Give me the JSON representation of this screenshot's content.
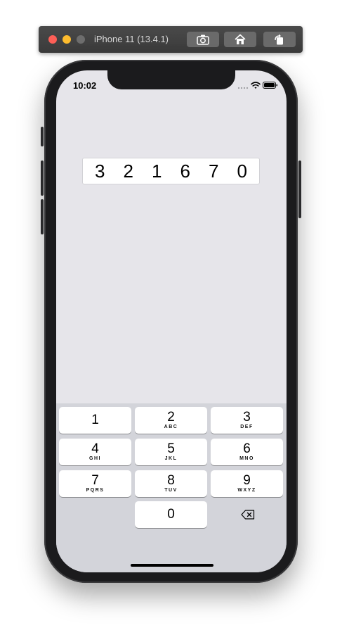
{
  "simulator": {
    "title": "iPhone 11 (13.4.1)",
    "buttons": [
      "screenshot-icon",
      "home-icon",
      "rotate-icon"
    ]
  },
  "status_bar": {
    "time": "10:02",
    "icons": [
      "cellular-icon",
      "wifi-icon",
      "battery-icon"
    ]
  },
  "code": {
    "digits": [
      "3",
      "2",
      "1",
      "6",
      "7",
      "0"
    ]
  },
  "keypad": {
    "keys": [
      {
        "number": "1",
        "letters": ""
      },
      {
        "number": "2",
        "letters": "ABC"
      },
      {
        "number": "3",
        "letters": "DEF"
      },
      {
        "number": "4",
        "letters": "GHI"
      },
      {
        "number": "5",
        "letters": "JKL"
      },
      {
        "number": "6",
        "letters": "MNO"
      },
      {
        "number": "7",
        "letters": "PQRS"
      },
      {
        "number": "8",
        "letters": "TUV"
      },
      {
        "number": "9",
        "letters": "WXYZ"
      },
      {
        "number": "0",
        "letters": ""
      }
    ],
    "delete_icon": "backspace-icon"
  },
  "colors": {
    "screen_background": "#e6e5ea",
    "keypad_background": "#d3d4da",
    "key_background": "#ffffff"
  }
}
